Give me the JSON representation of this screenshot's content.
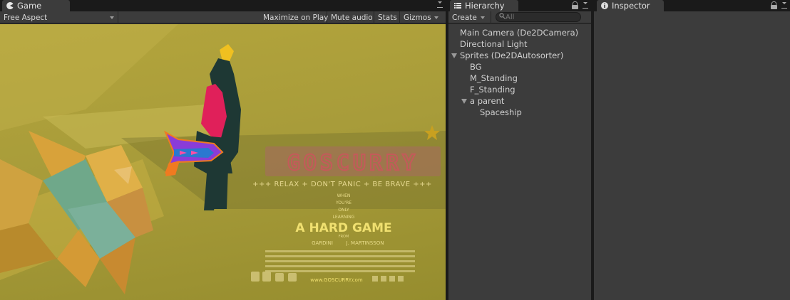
{
  "game": {
    "tab_label": "Game",
    "aspect_label": "Free Aspect",
    "toolbar": {
      "maximize": "Maximize on Play",
      "mute": "Mute audio",
      "stats": "Stats",
      "gizmos": "Gizmos"
    },
    "poster": {
      "logo": "GOSCURRY",
      "tagline": "+++ RELAX + DON'T PANIC + BE BRAVE +++",
      "small1": "WHEN",
      "small2": "YOU'RE",
      "small3": "ONLY",
      "small4": "LEARNING",
      "headline": "A HARD GAME",
      "from": "FROM",
      "credit_left": "GARDINI",
      "credit_right": "J. MARTINSSON",
      "url": "www.GOSCURRY.com"
    }
  },
  "hierarchy": {
    "tab_label": "Hierarchy",
    "create_label": "Create",
    "search_placeholder": "All",
    "items": [
      {
        "label": "Main Camera (De2DCamera)"
      },
      {
        "label": "Directional Light"
      },
      {
        "label": "Sprites (De2DAutosorter)"
      },
      {
        "label": "BG"
      },
      {
        "label": "M_Standing"
      },
      {
        "label": "F_Standing"
      },
      {
        "label": "a parent"
      },
      {
        "label": "Spaceship"
      }
    ]
  },
  "inspector": {
    "tab_label": "Inspector"
  },
  "icons": {
    "game_tab": "pacman-icon",
    "hierarchy_tab": "list-icon",
    "inspector_tab": "info-icon",
    "lock": "lock-icon",
    "menu": "panel-menu-icon",
    "search": "search-icon"
  },
  "colors": {
    "poster_bg": "#b4a53c",
    "logo": "#c45a5a",
    "spaceship": "#8a3cd8",
    "woman_dress": "#e0205a"
  }
}
